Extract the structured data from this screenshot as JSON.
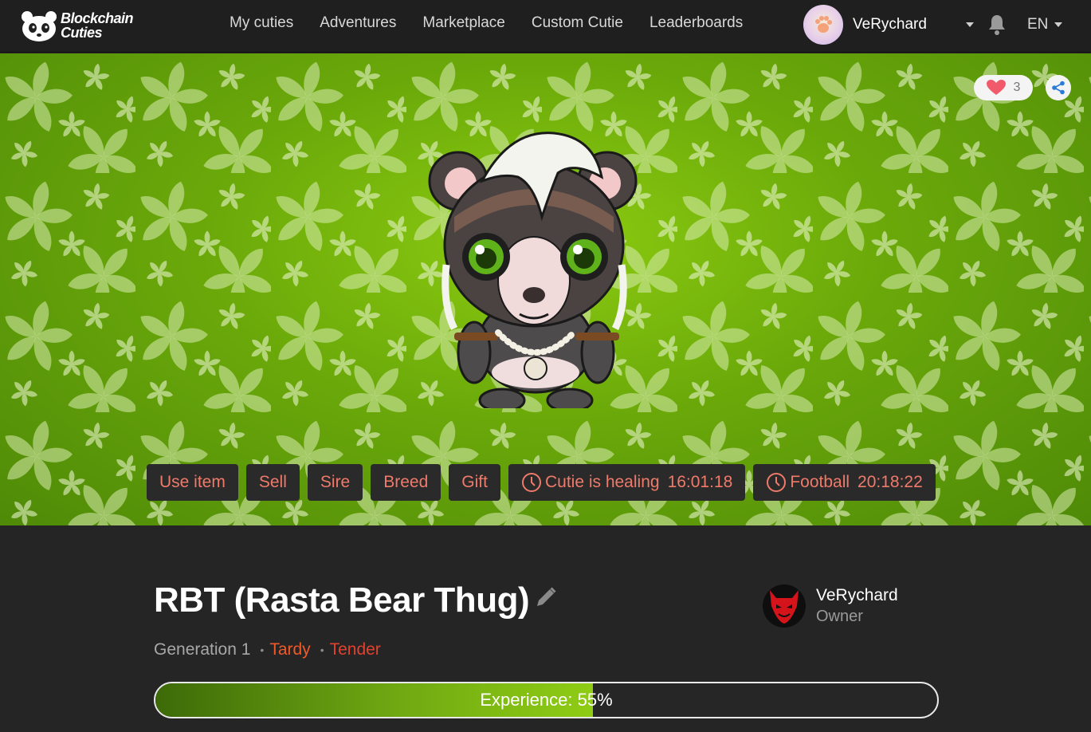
{
  "header": {
    "logo_line1": "Blockchain",
    "logo_line2": "Cuties",
    "nav": [
      "My cuties",
      "Adventures",
      "Marketplace",
      "Custom Cutie",
      "Leaderboards"
    ],
    "user_name": "VeRychard",
    "language": "EN"
  },
  "hero": {
    "like_count": "3",
    "icons": {
      "like": "heart-icon",
      "share": "share-icon"
    },
    "actions": {
      "use_item": "Use item",
      "sell": "Sell",
      "sire": "Sire",
      "breed": "Breed",
      "gift": "Gift"
    },
    "timers": [
      {
        "label": "Cutie is healing",
        "time": "16:01:18"
      },
      {
        "label": "Football",
        "time": "20:18:22"
      }
    ]
  },
  "cutie": {
    "name": "RBT (Rasta Bear Thug)",
    "generation": "Generation 1",
    "traits": [
      "Tardy",
      "Tender"
    ],
    "owner_name": "VeRychard",
    "owner_role": "Owner",
    "experience_label": "Experience: 55%",
    "experience_fraction": 0.56
  },
  "colors": {
    "accent_text": "#f07a6a",
    "trait_orange": "#f05a28",
    "trait_red": "#e0422e",
    "hero_green": "#7ab80c"
  }
}
